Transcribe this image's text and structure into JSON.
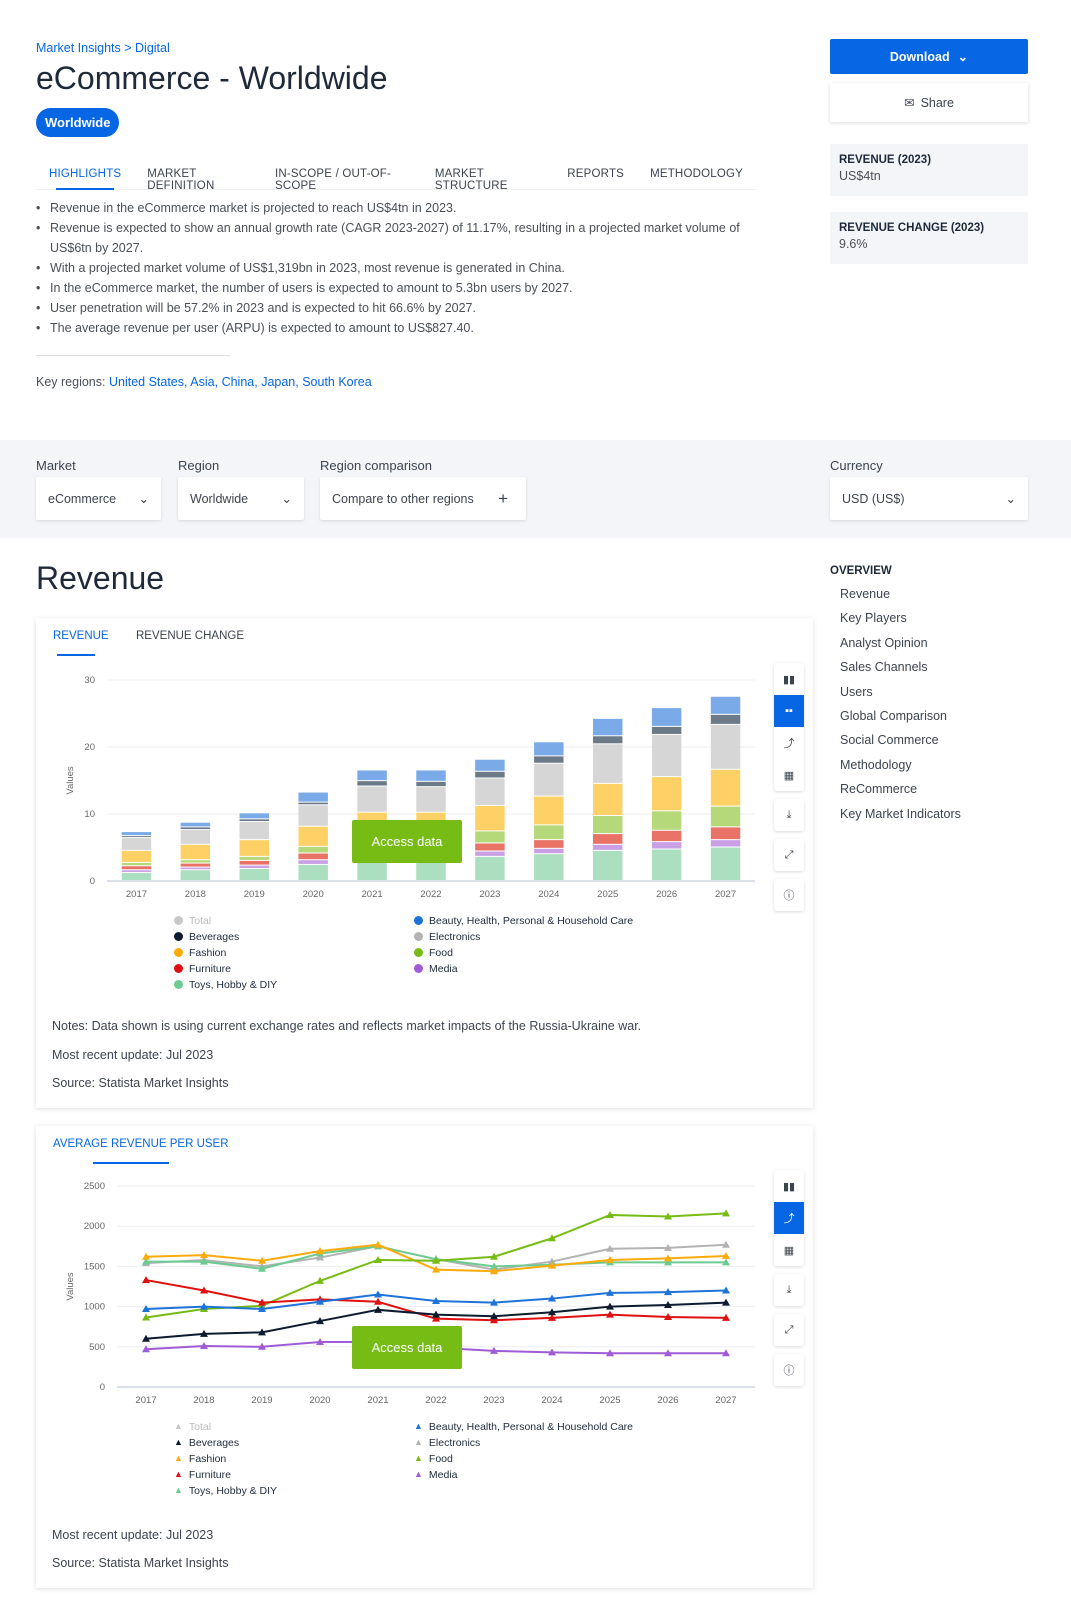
{
  "breadcrumb": {
    "part1": "Market Insights",
    "sep": " > ",
    "part2": "Digital"
  },
  "title": "eCommerce - Worldwide",
  "region_chip": "Worldwide",
  "tabs": [
    "HIGHLIGHTS",
    "MARKET DEFINITION",
    "IN-SCOPE / OUT-OF-SCOPE",
    "MARKET STRUCTURE",
    "REPORTS",
    "METHODOLOGY"
  ],
  "highlights": [
    "Revenue in the eCommerce market is projected to reach US$4tn in 2023.",
    "Revenue is expected to show an annual growth rate (CAGR 2023-2027) of 11.17%, resulting in a projected market volume of US$6tn by 2027.",
    "With a projected market volume of US$1,319bn in 2023, most revenue is generated in China.",
    "In the eCommerce market, the number of users is expected to amount to 5.3bn users by 2027.",
    "User penetration will be 57.2% in 2023 and is expected to hit 66.6% by 2027.",
    "The average revenue per user (ARPU) is expected to amount to US$827.40."
  ],
  "key_regions": {
    "label": "Key regions: ",
    "items": [
      "United States",
      "Asia",
      "China",
      "Japan",
      "South Korea"
    ]
  },
  "actions": {
    "download": "Download",
    "share": "Share"
  },
  "kpis": [
    {
      "label": "REVENUE (2023)",
      "value": "US$4tn"
    },
    {
      "label": "REVENUE CHANGE (2023)",
      "value": "9.6%"
    }
  ],
  "filters": {
    "market": {
      "label": "Market",
      "value": "eCommerce"
    },
    "region": {
      "label": "Region",
      "value": "Worldwide"
    },
    "comparison": {
      "label": "Region comparison",
      "value": "Compare to other regions"
    },
    "currency": {
      "label": "Currency",
      "value": "USD (US$)"
    }
  },
  "section_title": "Revenue",
  "overview": {
    "title": "OVERVIEW",
    "items": [
      "Revenue",
      "Key Players",
      "Analyst Opinion",
      "Sales Channels",
      "Users",
      "Global Comparison",
      "Social Commerce",
      "Methodology",
      "ReCommerce",
      "Key Market Indicators"
    ]
  },
  "colors": {
    "accent": "#0666e3",
    "access": "#76bc14"
  },
  "access_label": "Access data",
  "legend": [
    {
      "name": "Total",
      "color": "#c8c8c8"
    },
    {
      "name": "Beauty, Health, Personal & Household Care",
      "color": "#1e73d9"
    },
    {
      "name": "Beverages",
      "color": "#0d1b2e"
    },
    {
      "name": "Electronics",
      "color": "#b3b3b3"
    },
    {
      "name": "Fashion",
      "color": "#fcaa0c"
    },
    {
      "name": "Food",
      "color": "#76bc14"
    },
    {
      "name": "Furniture",
      "color": "#e01010"
    },
    {
      "name": "Media",
      "color": "#a05cd6"
    },
    {
      "name": "Toys, Hobby & DIY",
      "color": "#6ccb91"
    }
  ],
  "card1": {
    "tabs": [
      "REVENUE",
      "REVENUE CHANGE"
    ],
    "notes": "Notes: Data shown is using current exchange rates and reflects market impacts of the Russia-Ukraine war.",
    "update": "Most recent update: Jul 2023",
    "source": "Source: Statista Market Insights"
  },
  "card2": {
    "tabs": [
      "AVERAGE REVENUE PER USER"
    ],
    "update": "Most recent update: Jul 2023",
    "source": "Source: Statista Market Insights"
  },
  "chart_data": [
    {
      "type": "bar",
      "stacked": true,
      "ylabel": "Values",
      "ylim": [
        0,
        30
      ],
      "yticks": [
        0,
        10,
        20,
        30
      ],
      "grid": true,
      "legend": "bottom",
      "categories": [
        "2017",
        "2018",
        "2019",
        "2020",
        "2021",
        "2022",
        "2023",
        "2024",
        "2025",
        "2026",
        "2027"
      ],
      "series": [
        {
          "name": "Toys, Hobby & DIY",
          "color": "#acdec0",
          "values": [
            1.2,
            1.6,
            1.8,
            2.4,
            3.0,
            3.0,
            3.6,
            4.0,
            4.5,
            4.7,
            5.0
          ]
        },
        {
          "name": "Media",
          "color": "#c9a0e6",
          "values": [
            0.4,
            0.4,
            0.5,
            0.7,
            0.8,
            0.8,
            0.8,
            0.8,
            0.9,
            1.1,
            1.1
          ]
        },
        {
          "name": "Furniture",
          "color": "#e87366",
          "values": [
            0.6,
            0.6,
            0.7,
            1.0,
            1.2,
            1.2,
            1.2,
            1.3,
            1.6,
            1.7,
            1.9
          ]
        },
        {
          "name": "Food",
          "color": "#b4d87a",
          "values": [
            0.5,
            0.5,
            0.6,
            1.0,
            1.2,
            1.2,
            1.8,
            2.2,
            2.7,
            2.9,
            3.1
          ]
        },
        {
          "name": "Fashion",
          "color": "#fed166",
          "values": [
            1.8,
            2.3,
            2.5,
            3.0,
            4.0,
            4.0,
            3.8,
            4.3,
            4.8,
            5.1,
            5.5
          ]
        },
        {
          "name": "Electronics",
          "color": "#d6d6d6",
          "values": [
            1.9,
            2.2,
            2.7,
            3.2,
            3.9,
            3.8,
            4.1,
            4.9,
            5.9,
            6.3,
            6.7
          ]
        },
        {
          "name": "Beverages",
          "color": "#6c7a88",
          "values": [
            0.3,
            0.4,
            0.4,
            0.4,
            0.8,
            0.8,
            1.0,
            1.1,
            1.2,
            1.2,
            1.5
          ]
        },
        {
          "name": "Beauty, Health, Personal & Household Care",
          "color": "#7aaae8",
          "values": [
            0.6,
            0.7,
            0.9,
            1.5,
            1.6,
            1.7,
            1.8,
            2.1,
            2.6,
            2.8,
            2.7
          ]
        }
      ]
    },
    {
      "type": "line",
      "ylabel": "Values",
      "ylim": [
        0,
        2500
      ],
      "yticks": [
        0,
        500,
        1000,
        1500,
        2000,
        2500
      ],
      "grid": true,
      "legend": "bottom",
      "categories": [
        "2017",
        "2018",
        "2019",
        "2020",
        "2021",
        "2022",
        "2023",
        "2024",
        "2025",
        "2026",
        "2027"
      ],
      "series": [
        {
          "name": "Electronics",
          "color": "#b3b3b3",
          "values": [
            1540,
            1580,
            1500,
            1610,
            1750,
            1590,
            1460,
            1560,
            1720,
            1730,
            1770
          ]
        },
        {
          "name": "Toys, Hobby & DIY",
          "color": "#6ccb91",
          "values": [
            1560,
            1560,
            1470,
            1660,
            1750,
            1590,
            1500,
            1520,
            1550,
            1550,
            1550
          ]
        },
        {
          "name": "Fashion",
          "color": "#fcaa0c",
          "values": [
            1620,
            1640,
            1570,
            1690,
            1770,
            1460,
            1440,
            1510,
            1580,
            1600,
            1630
          ]
        },
        {
          "name": "Food",
          "color": "#76bc14",
          "values": [
            865,
            970,
            1010,
            1320,
            1580,
            1570,
            1620,
            1850,
            2140,
            2120,
            2160
          ]
        },
        {
          "name": "Furniture",
          "color": "#e01010",
          "values": [
            1330,
            1200,
            1050,
            1090,
            1060,
            850,
            830,
            860,
            900,
            870,
            860
          ]
        },
        {
          "name": "Beauty, Health, Personal & Household Care",
          "color": "#1e73d9",
          "values": [
            970,
            1000,
            970,
            1060,
            1150,
            1070,
            1050,
            1100,
            1170,
            1180,
            1200
          ]
        },
        {
          "name": "Beverages",
          "color": "#0d1b2e",
          "values": [
            600,
            660,
            680,
            820,
            960,
            900,
            880,
            930,
            1000,
            1020,
            1050
          ]
        },
        {
          "name": "Media",
          "color": "#a05cd6",
          "values": [
            470,
            510,
            500,
            560,
            560,
            490,
            450,
            430,
            420,
            420,
            420
          ]
        }
      ]
    }
  ]
}
